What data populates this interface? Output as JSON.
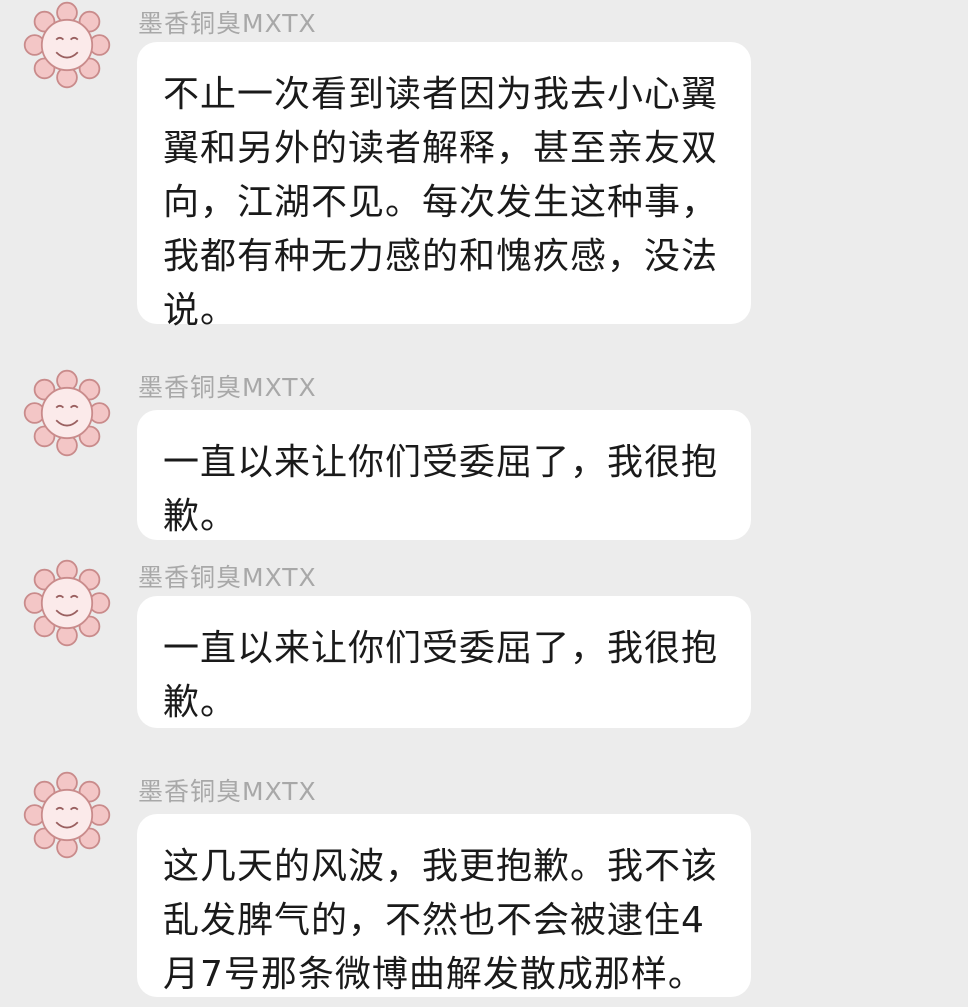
{
  "colors": {
    "background": "#ececec",
    "bubble": "#ffffff",
    "text": "#1a1a1a",
    "sender_name": "#a8a8a8",
    "avatar_petal": "#f3c6c6",
    "avatar_outline": "#c98b8b"
  },
  "messages": [
    {
      "sender": "墨香铜臭MXTX",
      "avatar_icon": "sunflower-face-icon",
      "text": "不止一次看到读者因为我去小心翼翼和另外的读者解释，甚至亲友双向，江湖不见。每次发生这种事，我都有种无力感的和愧疚感，没法说。"
    },
    {
      "sender": "墨香铜臭MXTX",
      "avatar_icon": "sunflower-face-icon",
      "text": "一直以来让你们受委屈了，我很抱歉。"
    },
    {
      "sender": "墨香铜臭MXTX",
      "avatar_icon": "sunflower-face-icon",
      "text": "一直以来让你们受委屈了，我很抱歉。"
    },
    {
      "sender": "墨香铜臭MXTX",
      "avatar_icon": "sunflower-face-icon",
      "text": "这几天的风波，我更抱歉。我不该乱发脾气的，不然也不会被逮住4月7号那条微博曲解发散成那样。"
    }
  ]
}
